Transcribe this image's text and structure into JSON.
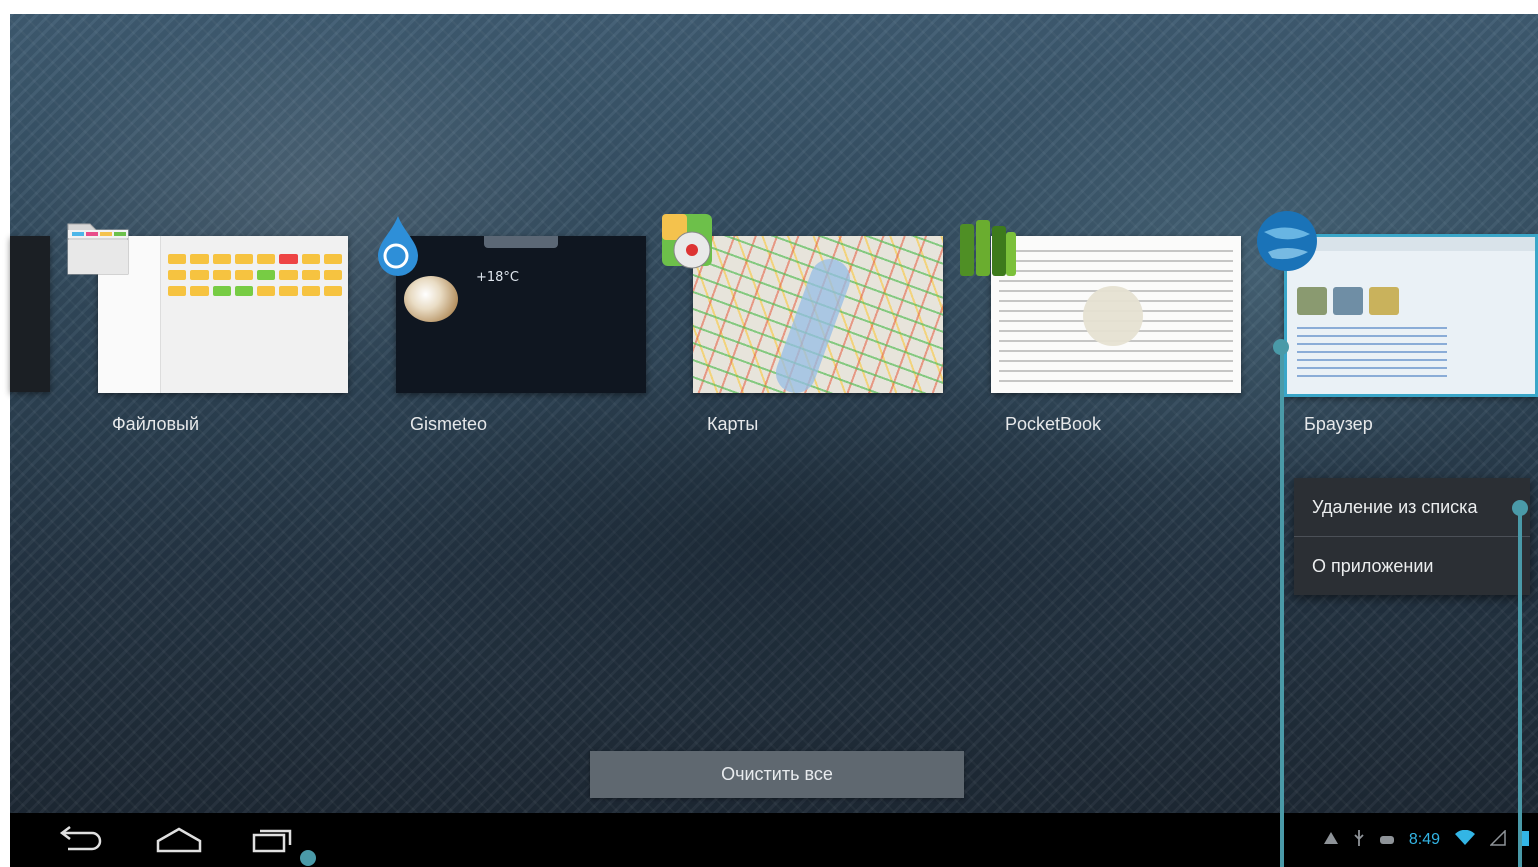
{
  "recents": {
    "apps": [
      {
        "label": "Файловый ",
        "icon": "folder-icon"
      },
      {
        "label": "Gismeteo",
        "icon": "weather-drop-icon",
        "thumb_temp": "+18°C"
      },
      {
        "label": "Карты",
        "icon": "maps-pin-icon"
      },
      {
        "label": "PocketBook",
        "icon": "books-icon"
      },
      {
        "label": "Браузер",
        "icon": "globe-icon"
      }
    ],
    "clear_all_label": "Очистить все"
  },
  "context_menu": {
    "items": [
      {
        "label": "Удаление из списка"
      },
      {
        "label": "О приложении"
      }
    ]
  },
  "navbar": {
    "back": "back-icon",
    "home": "home-icon",
    "recents": "recent-apps-icon"
  },
  "status_bar": {
    "time": "8:49",
    "icons": [
      "warning-icon",
      "usb-icon",
      "android-debug-icon",
      "wifi-icon",
      "signal-icon",
      "battery-icon"
    ]
  },
  "colors": {
    "accent": "#33b5e5",
    "annotation": "#4a9aa8",
    "menu_bg": "#2b2f34"
  }
}
